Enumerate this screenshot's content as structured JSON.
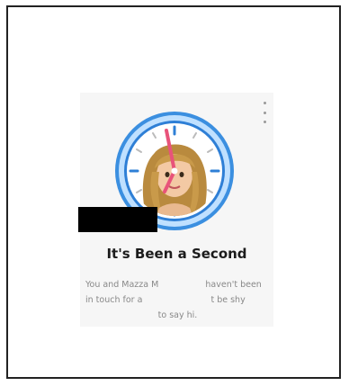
{
  "card": {
    "title": "It's Been a Second",
    "message": {
      "line1_a": "You and Mazza M",
      "line1_b": "haven't been",
      "line2_a": "in touch for a",
      "line2_b": "t be shy",
      "line3": "to say hi."
    }
  },
  "menu": {
    "icon": "more-vertical-icon"
  },
  "clock": {
    "icon": "clock-ring-icon",
    "accent": "#3b8fe0",
    "hand_color": "#e8537a"
  },
  "colors": {
    "frame_border": "#222222",
    "card_background": "#f6f6f6",
    "redaction": "#000000"
  }
}
